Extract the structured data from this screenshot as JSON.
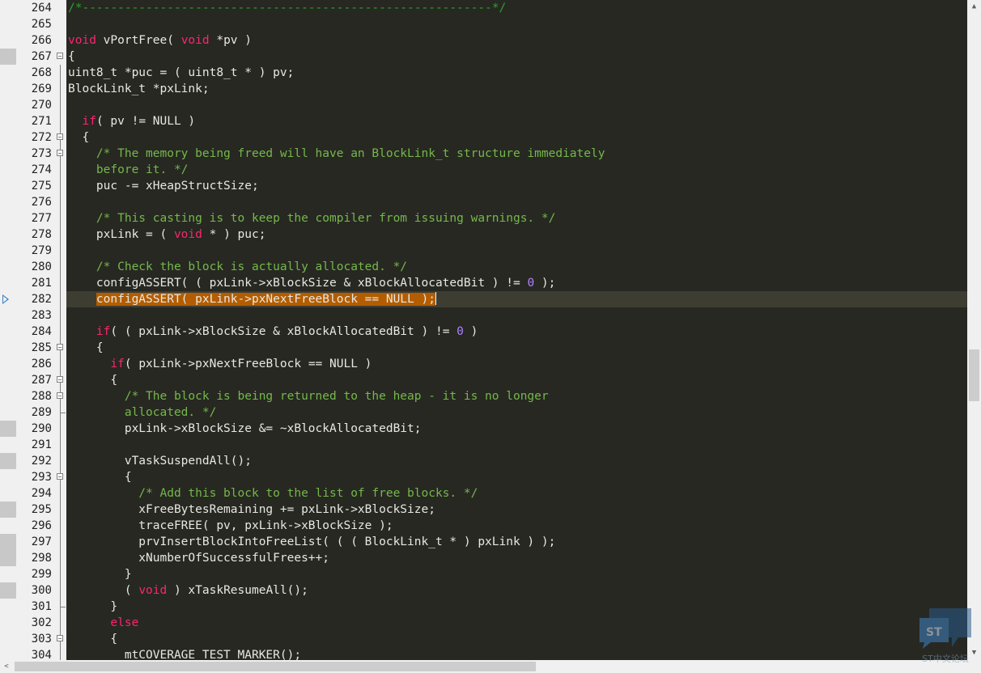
{
  "colors": {
    "background": "#272822",
    "keyword": "#f92672",
    "comment": "#29a329",
    "number": "#ae81ff",
    "text": "#e8e8e2",
    "selection": "#b35d00",
    "current_line": "#3e3d32",
    "gutter": "#f0f0f0",
    "bookmark": "#3a7fc4"
  },
  "icons": {
    "fold": "fold-minus-box-icon",
    "bookmark": "bookmark-arrow-icon",
    "scroll_up": "▲",
    "scroll_down": "▼",
    "scroll_left": "<"
  },
  "lines": [
    {
      "n": "264",
      "tokens": [
        {
          "t": "/*----------------------------------------------------------*/",
          "c": "cm"
        }
      ]
    },
    {
      "n": "265",
      "tokens": []
    },
    {
      "n": "266",
      "tokens": [
        {
          "t": "void",
          "c": "kw"
        },
        {
          "t": " vPortFree( ",
          "c": "tx"
        },
        {
          "t": "void",
          "c": "kw"
        },
        {
          "t": " *pv )",
          "c": "tx"
        }
      ]
    },
    {
      "n": "267",
      "tokens": [
        {
          "t": "{",
          "c": "tx"
        }
      ]
    },
    {
      "n": "268",
      "tokens": [
        {
          "t": "uint8_t *puc = ( uint8_t * ) pv;",
          "c": "tx"
        }
      ]
    },
    {
      "n": "269",
      "tokens": [
        {
          "t": "BlockLink_t *pxLink;",
          "c": "tx"
        }
      ]
    },
    {
      "n": "270",
      "tokens": []
    },
    {
      "n": "271",
      "tokens": [
        {
          "t": "  ",
          "c": "tx"
        },
        {
          "t": "if",
          "c": "kw"
        },
        {
          "t": "( pv != NULL )",
          "c": "tx"
        }
      ]
    },
    {
      "n": "272",
      "tokens": [
        {
          "t": "  {",
          "c": "tx"
        }
      ]
    },
    {
      "n": "273",
      "tokens": [
        {
          "t": "    /* The memory being freed will have an BlockLink_t structure immediately",
          "c": "cm2"
        }
      ]
    },
    {
      "n": "274",
      "tokens": [
        {
          "t": "    before it. */",
          "c": "cm2"
        }
      ]
    },
    {
      "n": "275",
      "tokens": [
        {
          "t": "    puc -= xHeapStructSize;",
          "c": "tx"
        }
      ]
    },
    {
      "n": "276",
      "tokens": []
    },
    {
      "n": "277",
      "tokens": [
        {
          "t": "    /* This casting is to keep the compiler from issuing warnings. */",
          "c": "cm2"
        }
      ]
    },
    {
      "n": "278",
      "tokens": [
        {
          "t": "    pxLink = ( ",
          "c": "tx"
        },
        {
          "t": "void",
          "c": "kw"
        },
        {
          "t": " * ) puc;",
          "c": "tx"
        }
      ]
    },
    {
      "n": "279",
      "tokens": []
    },
    {
      "n": "280",
      "tokens": [
        {
          "t": "    /* Check the block is actually allocated. */",
          "c": "cm2"
        }
      ]
    },
    {
      "n": "281",
      "tokens": [
        {
          "t": "    configASSERT( ( pxLink->xBlockSize & xBlockAllocatedBit ) != ",
          "c": "tx"
        },
        {
          "t": "0",
          "c": "num"
        },
        {
          "t": " );",
          "c": "tx"
        }
      ]
    },
    {
      "n": "282",
      "tokens": [
        {
          "t": "    ",
          "c": "tx"
        },
        {
          "t": "configASSERT( pxLink->pxNextFreeBlock == NULL );",
          "c": "tx sel"
        }
      ]
    },
    {
      "n": "283",
      "tokens": []
    },
    {
      "n": "284",
      "tokens": [
        {
          "t": "    ",
          "c": "tx"
        },
        {
          "t": "if",
          "c": "kw"
        },
        {
          "t": "( ( pxLink->xBlockSize & xBlockAllocatedBit ) != ",
          "c": "tx"
        },
        {
          "t": "0",
          "c": "num"
        },
        {
          "t": " )",
          "c": "tx"
        }
      ]
    },
    {
      "n": "285",
      "tokens": [
        {
          "t": "    {",
          "c": "tx"
        }
      ]
    },
    {
      "n": "286",
      "tokens": [
        {
          "t": "      ",
          "c": "tx"
        },
        {
          "t": "if",
          "c": "kw"
        },
        {
          "t": "( pxLink->pxNextFreeBlock == NULL )",
          "c": "tx"
        }
      ]
    },
    {
      "n": "287",
      "tokens": [
        {
          "t": "      {",
          "c": "tx"
        }
      ]
    },
    {
      "n": "288",
      "tokens": [
        {
          "t": "        /* The block is being returned to the heap - it is no longer",
          "c": "cm2"
        }
      ]
    },
    {
      "n": "289",
      "tokens": [
        {
          "t": "        allocated. */",
          "c": "cm2"
        }
      ]
    },
    {
      "n": "290",
      "tokens": [
        {
          "t": "        pxLink->xBlockSize &= ~xBlockAllocatedBit;",
          "c": "tx"
        }
      ]
    },
    {
      "n": "291",
      "tokens": []
    },
    {
      "n": "292",
      "tokens": [
        {
          "t": "        vTaskSuspendAll();",
          "c": "tx"
        }
      ]
    },
    {
      "n": "293",
      "tokens": [
        {
          "t": "        {",
          "c": "tx"
        }
      ]
    },
    {
      "n": "294",
      "tokens": [
        {
          "t": "          /* Add this block to the list of free blocks. */",
          "c": "cm2"
        }
      ]
    },
    {
      "n": "295",
      "tokens": [
        {
          "t": "          xFreeBytesRemaining += pxLink->xBlockSize;",
          "c": "tx"
        }
      ]
    },
    {
      "n": "296",
      "tokens": [
        {
          "t": "          traceFREE( pv, pxLink->xBlockSize );",
          "c": "tx"
        }
      ]
    },
    {
      "n": "297",
      "tokens": [
        {
          "t": "          prvInsertBlockIntoFreeList( ( ( BlockLink_t * ) pxLink ) );",
          "c": "tx"
        }
      ]
    },
    {
      "n": "298",
      "tokens": [
        {
          "t": "          xNumberOfSuccessfulFrees++;",
          "c": "tx"
        }
      ]
    },
    {
      "n": "299",
      "tokens": [
        {
          "t": "        }",
          "c": "tx"
        }
      ]
    },
    {
      "n": "300",
      "tokens": [
        {
          "t": "        ( ",
          "c": "tx"
        },
        {
          "t": "void",
          "c": "kw"
        },
        {
          "t": " ) xTaskResumeAll();",
          "c": "tx"
        }
      ]
    },
    {
      "n": "301",
      "tokens": [
        {
          "t": "      }",
          "c": "tx"
        }
      ]
    },
    {
      "n": "302",
      "tokens": [
        {
          "t": "      ",
          "c": "tx"
        },
        {
          "t": "else",
          "c": "kw"
        }
      ]
    },
    {
      "n": "303",
      "tokens": [
        {
          "t": "      {",
          "c": "tx"
        }
      ]
    },
    {
      "n": "304",
      "tokens": [
        {
          "t": "        mtCOVERAGE_TEST_MARKER();",
          "c": "tx"
        }
      ]
    }
  ],
  "watermark": {
    "text": "ST中文论坛"
  }
}
